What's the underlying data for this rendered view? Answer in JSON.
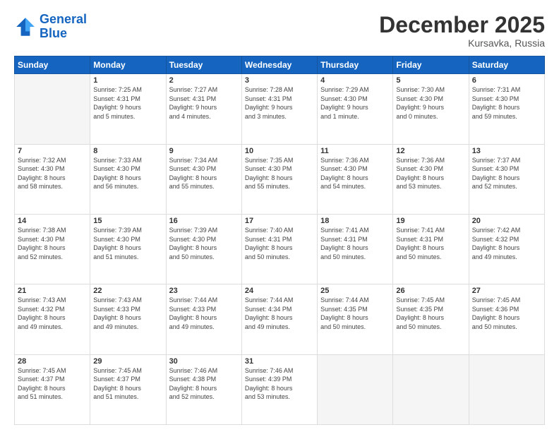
{
  "header": {
    "logo_line1": "General",
    "logo_line2": "Blue",
    "month": "December 2025",
    "location": "Kursavka, Russia"
  },
  "days_of_week": [
    "Sunday",
    "Monday",
    "Tuesday",
    "Wednesday",
    "Thursday",
    "Friday",
    "Saturday"
  ],
  "weeks": [
    [
      {
        "num": "",
        "info": ""
      },
      {
        "num": "1",
        "info": "Sunrise: 7:25 AM\nSunset: 4:31 PM\nDaylight: 9 hours\nand 5 minutes."
      },
      {
        "num": "2",
        "info": "Sunrise: 7:27 AM\nSunset: 4:31 PM\nDaylight: 9 hours\nand 4 minutes."
      },
      {
        "num": "3",
        "info": "Sunrise: 7:28 AM\nSunset: 4:31 PM\nDaylight: 9 hours\nand 3 minutes."
      },
      {
        "num": "4",
        "info": "Sunrise: 7:29 AM\nSunset: 4:30 PM\nDaylight: 9 hours\nand 1 minute."
      },
      {
        "num": "5",
        "info": "Sunrise: 7:30 AM\nSunset: 4:30 PM\nDaylight: 9 hours\nand 0 minutes."
      },
      {
        "num": "6",
        "info": "Sunrise: 7:31 AM\nSunset: 4:30 PM\nDaylight: 8 hours\nand 59 minutes."
      }
    ],
    [
      {
        "num": "7",
        "info": "Sunrise: 7:32 AM\nSunset: 4:30 PM\nDaylight: 8 hours\nand 58 minutes."
      },
      {
        "num": "8",
        "info": "Sunrise: 7:33 AM\nSunset: 4:30 PM\nDaylight: 8 hours\nand 56 minutes."
      },
      {
        "num": "9",
        "info": "Sunrise: 7:34 AM\nSunset: 4:30 PM\nDaylight: 8 hours\nand 55 minutes."
      },
      {
        "num": "10",
        "info": "Sunrise: 7:35 AM\nSunset: 4:30 PM\nDaylight: 8 hours\nand 55 minutes."
      },
      {
        "num": "11",
        "info": "Sunrise: 7:36 AM\nSunset: 4:30 PM\nDaylight: 8 hours\nand 54 minutes."
      },
      {
        "num": "12",
        "info": "Sunrise: 7:36 AM\nSunset: 4:30 PM\nDaylight: 8 hours\nand 53 minutes."
      },
      {
        "num": "13",
        "info": "Sunrise: 7:37 AM\nSunset: 4:30 PM\nDaylight: 8 hours\nand 52 minutes."
      }
    ],
    [
      {
        "num": "14",
        "info": "Sunrise: 7:38 AM\nSunset: 4:30 PM\nDaylight: 8 hours\nand 52 minutes."
      },
      {
        "num": "15",
        "info": "Sunrise: 7:39 AM\nSunset: 4:30 PM\nDaylight: 8 hours\nand 51 minutes."
      },
      {
        "num": "16",
        "info": "Sunrise: 7:39 AM\nSunset: 4:30 PM\nDaylight: 8 hours\nand 50 minutes."
      },
      {
        "num": "17",
        "info": "Sunrise: 7:40 AM\nSunset: 4:31 PM\nDaylight: 8 hours\nand 50 minutes."
      },
      {
        "num": "18",
        "info": "Sunrise: 7:41 AM\nSunset: 4:31 PM\nDaylight: 8 hours\nand 50 minutes."
      },
      {
        "num": "19",
        "info": "Sunrise: 7:41 AM\nSunset: 4:31 PM\nDaylight: 8 hours\nand 50 minutes."
      },
      {
        "num": "20",
        "info": "Sunrise: 7:42 AM\nSunset: 4:32 PM\nDaylight: 8 hours\nand 49 minutes."
      }
    ],
    [
      {
        "num": "21",
        "info": "Sunrise: 7:43 AM\nSunset: 4:32 PM\nDaylight: 8 hours\nand 49 minutes."
      },
      {
        "num": "22",
        "info": "Sunrise: 7:43 AM\nSunset: 4:33 PM\nDaylight: 8 hours\nand 49 minutes."
      },
      {
        "num": "23",
        "info": "Sunrise: 7:44 AM\nSunset: 4:33 PM\nDaylight: 8 hours\nand 49 minutes."
      },
      {
        "num": "24",
        "info": "Sunrise: 7:44 AM\nSunset: 4:34 PM\nDaylight: 8 hours\nand 49 minutes."
      },
      {
        "num": "25",
        "info": "Sunrise: 7:44 AM\nSunset: 4:35 PM\nDaylight: 8 hours\nand 50 minutes."
      },
      {
        "num": "26",
        "info": "Sunrise: 7:45 AM\nSunset: 4:35 PM\nDaylight: 8 hours\nand 50 minutes."
      },
      {
        "num": "27",
        "info": "Sunrise: 7:45 AM\nSunset: 4:36 PM\nDaylight: 8 hours\nand 50 minutes."
      }
    ],
    [
      {
        "num": "28",
        "info": "Sunrise: 7:45 AM\nSunset: 4:37 PM\nDaylight: 8 hours\nand 51 minutes."
      },
      {
        "num": "29",
        "info": "Sunrise: 7:45 AM\nSunset: 4:37 PM\nDaylight: 8 hours\nand 51 minutes."
      },
      {
        "num": "30",
        "info": "Sunrise: 7:46 AM\nSunset: 4:38 PM\nDaylight: 8 hours\nand 52 minutes."
      },
      {
        "num": "31",
        "info": "Sunrise: 7:46 AM\nSunset: 4:39 PM\nDaylight: 8 hours\nand 53 minutes."
      },
      {
        "num": "",
        "info": ""
      },
      {
        "num": "",
        "info": ""
      },
      {
        "num": "",
        "info": ""
      }
    ]
  ]
}
